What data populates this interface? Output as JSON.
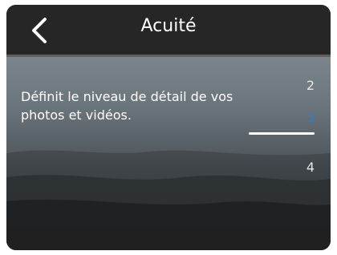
{
  "header": {
    "title": "Acuité",
    "back_icon": "chevron-left-icon"
  },
  "content": {
    "description": "Définit le niveau de détail de vos photos et vidéos."
  },
  "picker": {
    "levels": [
      "2",
      "3",
      "4"
    ],
    "selected": "3",
    "selected_color": "#2f7be0"
  }
}
